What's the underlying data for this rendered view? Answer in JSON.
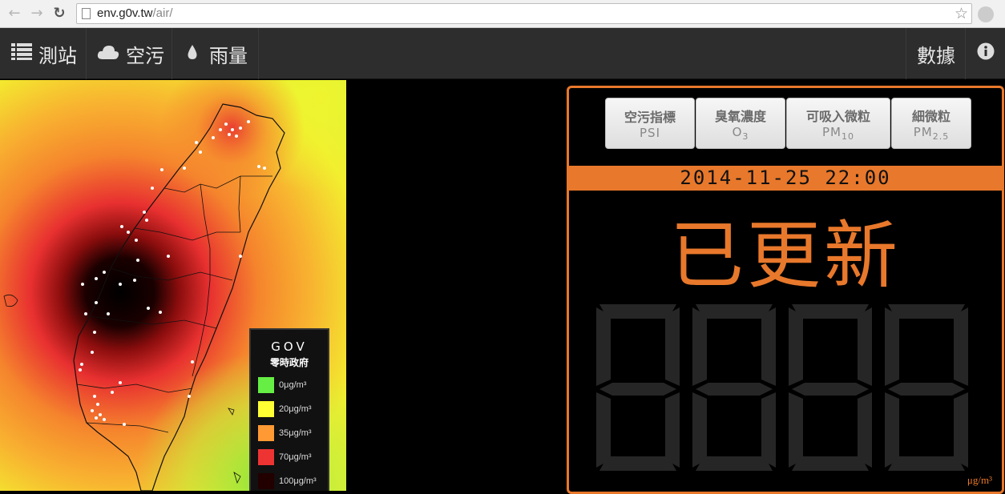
{
  "browser": {
    "url_host": "env.g0v.tw",
    "url_path": "/air/"
  },
  "navbar": {
    "items": [
      {
        "label": "測站",
        "icon": "list-icon"
      },
      {
        "label": "空污",
        "icon": "cloud-icon"
      },
      {
        "label": "雨量",
        "icon": "drop-icon"
      }
    ],
    "right": {
      "label": "數據"
    },
    "info_icon": "info-icon"
  },
  "legend": {
    "logo": "GOV",
    "title": "零時政府",
    "levels": [
      {
        "label": "0μg/m³",
        "color": "#66ee44"
      },
      {
        "label": "20μg/m³",
        "color": "#ffff33"
      },
      {
        "label": "35μg/m³",
        "color": "#ff9933"
      },
      {
        "label": "70μg/m³",
        "color": "#ee3333"
      },
      {
        "label": "100μg/m³",
        "color": "#220000"
      }
    ]
  },
  "panel": {
    "tabs": [
      {
        "zh": "空污指標",
        "en": "PSI",
        "sub": ""
      },
      {
        "zh": "臭氧濃度",
        "en": "O",
        "sub": "3"
      },
      {
        "zh": "可吸入微粒",
        "en": "PM",
        "sub": "10"
      },
      {
        "zh": "細微粒",
        "en": "PM",
        "sub": "2.5"
      }
    ],
    "timestamp": "2014-11-25 22:00",
    "status": "已更新",
    "unit": "μg/m³"
  },
  "colors": {
    "accent": "#e8782b",
    "navbar": "#2d2d2d"
  }
}
